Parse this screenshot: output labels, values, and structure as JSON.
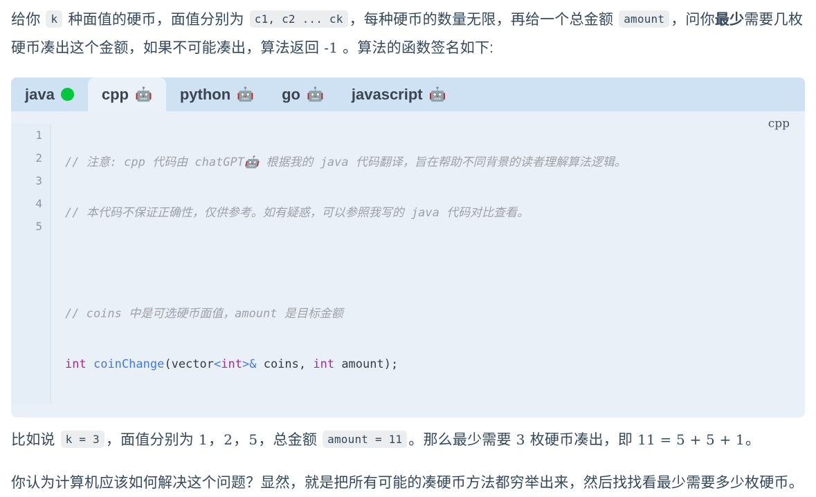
{
  "paragraph1": {
    "seg1": "给你 ",
    "code_k": "k",
    "seg2": " 种面值的硬币，面值分别为 ",
    "code_coins": "c1, c2 ... ck",
    "seg3": "，每种硬币的数量无限，再给一个总金额 ",
    "code_amount": "amount",
    "seg4": "，问你",
    "bold1": "最少",
    "seg5": "需要几枚硬币凑出这个金额，如果不可能凑出，算法返回 ",
    "math_neg1": "-1",
    "seg6": " 。算法的函数签名如下:"
  },
  "code_widget": {
    "lang_badge": "cpp",
    "tabs": [
      {
        "label": "java",
        "icon": "green-dot-icon",
        "emoji": "",
        "active": false
      },
      {
        "label": "cpp",
        "icon": "robot-icon",
        "emoji": "🤖",
        "active": true
      },
      {
        "label": "python",
        "icon": "robot-icon",
        "emoji": "🤖",
        "active": false
      },
      {
        "label": "go",
        "icon": "robot-icon",
        "emoji": "🤖",
        "active": false
      },
      {
        "label": "javascript",
        "icon": "robot-icon",
        "emoji": "🤖",
        "active": false
      }
    ],
    "line_numbers": [
      "1",
      "2",
      "3",
      "4",
      "5"
    ],
    "lines": [
      {
        "n": "1",
        "text": "// 注意: cpp 代码由 chatGPT🤖 根据我的 java 代码翻译，旨在帮助不同背景的读者理解算法逻辑。",
        "type": "comment"
      },
      {
        "n": "2",
        "text": "// 本代码不保证正确性，仅供参考。如有疑惑，可以参照我写的 java 代码对比查看。",
        "type": "comment"
      },
      {
        "n": "3",
        "text": "",
        "type": "blank"
      },
      {
        "n": "4",
        "text": "// coins 中是可选硬币面值，amount 是目标金额",
        "type": "comment"
      },
      {
        "n": "5",
        "text": "int coinChange(vector<int>& coins, int amount);",
        "type": "code"
      }
    ],
    "line5_tokens": {
      "kw_int1": "int",
      "space1": " ",
      "fn_name": "coinChange",
      "paren_open": "(",
      "vector": "vector",
      "lt": "<",
      "kw_int2": "int",
      "gt": ">",
      "amp": "&",
      "args1": " coins, ",
      "kw_int3": "int",
      "args2": " amount);"
    }
  },
  "paragraph2": {
    "seg1": "比如说 ",
    "code_k3": "k = 3",
    "seg2": "，面值分别为 ",
    "m1": "1",
    "seg3": "，",
    "m2": "2",
    "seg4": "，",
    "m5": "5",
    "seg5": "，总金额 ",
    "code_amount11": "amount = 11",
    "seg6": "。那么最少需要 ",
    "m3": "3",
    "seg7": " 枚硬币凑出，即 ",
    "m_eq": "11 = 5 + 5 + 1",
    "seg8": "。"
  },
  "paragraph3": {
    "text": "你认为计算机应该如何解决这个问题？显然，就是把所有可能的凑硬币方法都穷举出来，然后找找看最少需要多少枚硬币。"
  },
  "colors": {
    "text": "#34495e",
    "tabbar_bg": "#cfe2f3",
    "active_tab_bg": "#eaf1f8",
    "code_bg": "#e9f0f8",
    "gutter_bg": "#e5edf7",
    "inline_code_bg": "#ecedef",
    "comment": "#a0a1a7",
    "keyword": "#a626a4",
    "function": "#4078f2",
    "green_dot": "#00c73c"
  }
}
